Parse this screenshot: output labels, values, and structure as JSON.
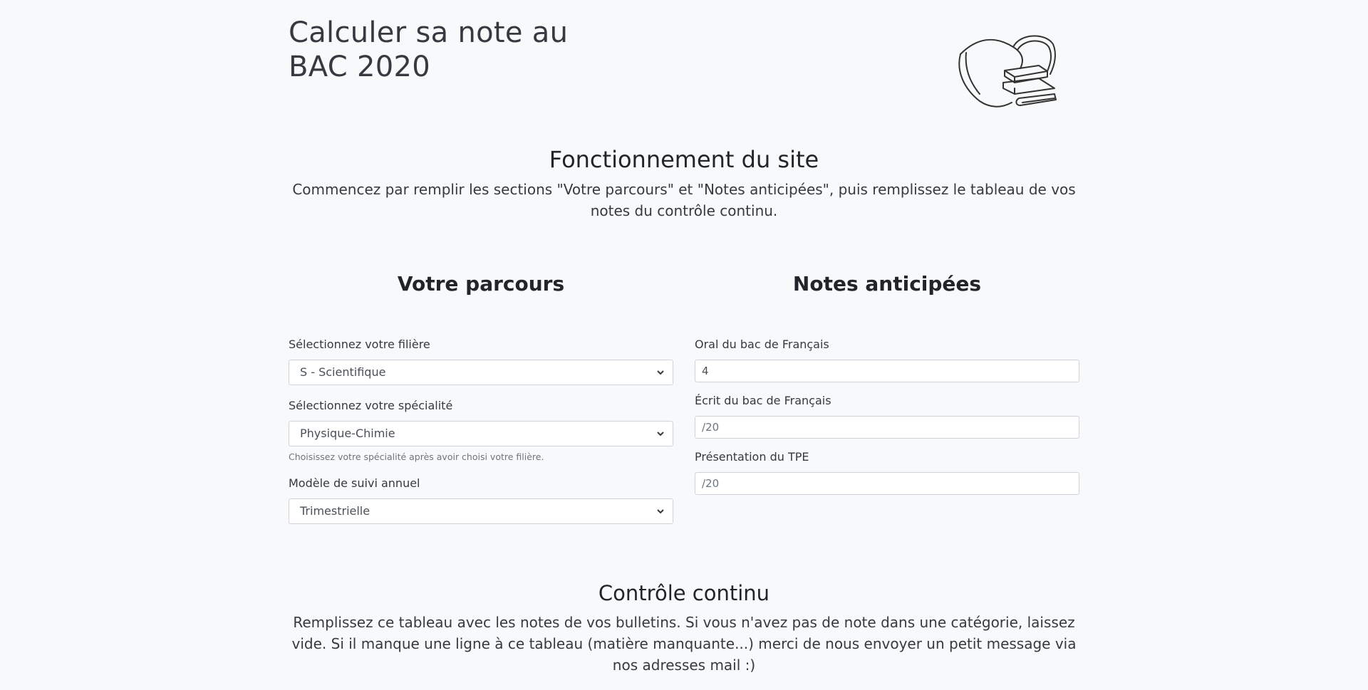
{
  "header": {
    "title_line1": "Calculer sa note au",
    "title_line2": "BAC 2020",
    "logo_icon": "mask-books-icon"
  },
  "intro": {
    "heading": "Fonctionnement du site",
    "text_line1": "Commencez par remplir les sections \"Votre parcours\" et \"Notes anticipées\", puis remplissez le tableau de vos",
    "text_line2": "notes du contrôle continu."
  },
  "parcours": {
    "heading": "Votre parcours",
    "filiere_label": "Sélectionnez votre filière",
    "filiere_value": "S - Scientifique",
    "specialite_label": "Sélectionnez votre spécialité",
    "specialite_value": "Physique-Chimie",
    "specialite_help": "Choisissez votre spécialité après avoir choisi votre filière.",
    "suivi_label": "Modèle de suivi annuel",
    "suivi_value": "Trimestrielle"
  },
  "anticipees": {
    "heading": "Notes anticipées",
    "oral_label": "Oral du bac de Français",
    "oral_value": "4",
    "ecrit_label": "Écrit du bac de Français",
    "ecrit_placeholder": "/20",
    "tpe_label": "Présentation du TPE",
    "tpe_placeholder": "/20"
  },
  "controle": {
    "heading": "Contrôle continu",
    "text_line1": "Remplissez ce tableau avec les notes de vos bulletins. Si vous n'avez pas de note dans une catégorie, laissez",
    "text_line2": "vide. Si il manque une ligne à ce tableau (matière manquante...) merci de nous envoyer un petit message via",
    "text_line3": "nos adresses mail :)"
  }
}
